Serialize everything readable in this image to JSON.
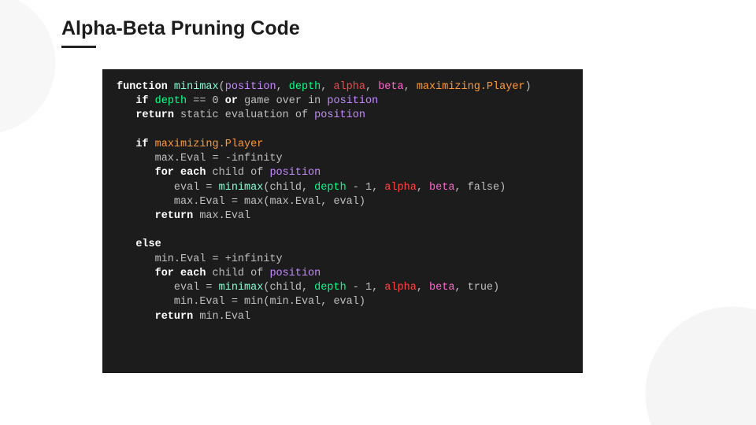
{
  "title": "Alpha-Beta Pruning Code",
  "code": {
    "l01": {
      "kw_function": "function",
      "fn": "minimax",
      "paren_open": "(",
      "pos": "position",
      "c1": ", ",
      "dep": "depth",
      "c2": ", ",
      "al": "alpha",
      "c3": ", ",
      "be": "beta",
      "c4": ", ",
      "mp": "maximizing.Player",
      "paren_close": ")"
    },
    "l02": {
      "indent": "   ",
      "kw_if": "if",
      "sp": " ",
      "dep": "depth",
      "eq": " == ",
      "zero": "0",
      "sp2": " ",
      "kw_or": "or",
      "rest": " game over in ",
      "pos": "position"
    },
    "l03": {
      "indent": "   ",
      "kw_return": "return",
      "rest": " static evaluation of ",
      "pos": "position"
    },
    "l05": {
      "indent": "   ",
      "kw_if": "if",
      "sp": " ",
      "mp": "maximizing.Player"
    },
    "l06": {
      "indent": "      ",
      "txt": "max.Eval = -infinity"
    },
    "l07": {
      "indent": "      ",
      "kw_for": "for each",
      "rest": " child of ",
      "pos": "position"
    },
    "l08": {
      "indent": "         ",
      "pre": "eval = ",
      "fn": "minimax",
      "open": "(child, ",
      "dep": "depth",
      "mid": " - 1, ",
      "al": "alpha",
      "c": ", ",
      "be": "beta",
      "end": ", false)"
    },
    "l09": {
      "indent": "         ",
      "txt": "max.Eval = max(max.Eval, eval)"
    },
    "l10": {
      "indent": "      ",
      "kw_return": "return",
      "rest": " max.Eval"
    },
    "l12": {
      "indent": "   ",
      "kw_else": "else"
    },
    "l13": {
      "indent": "      ",
      "txt": "min.Eval = +infinity"
    },
    "l14": {
      "indent": "      ",
      "kw_for": "for each",
      "rest": " child of ",
      "pos": "position"
    },
    "l15": {
      "indent": "         ",
      "pre": "eval = ",
      "fn": "minimax",
      "open": "(child, ",
      "dep": "depth",
      "mid": " - 1, ",
      "al": "alpha",
      "c": ", ",
      "be": "beta",
      "end": ", true)"
    },
    "l16": {
      "indent": "         ",
      "txt": "min.Eval = min(min.Eval, eval)"
    },
    "l17": {
      "indent": "      ",
      "kw_return": "return",
      "rest": " min.Eval"
    }
  }
}
